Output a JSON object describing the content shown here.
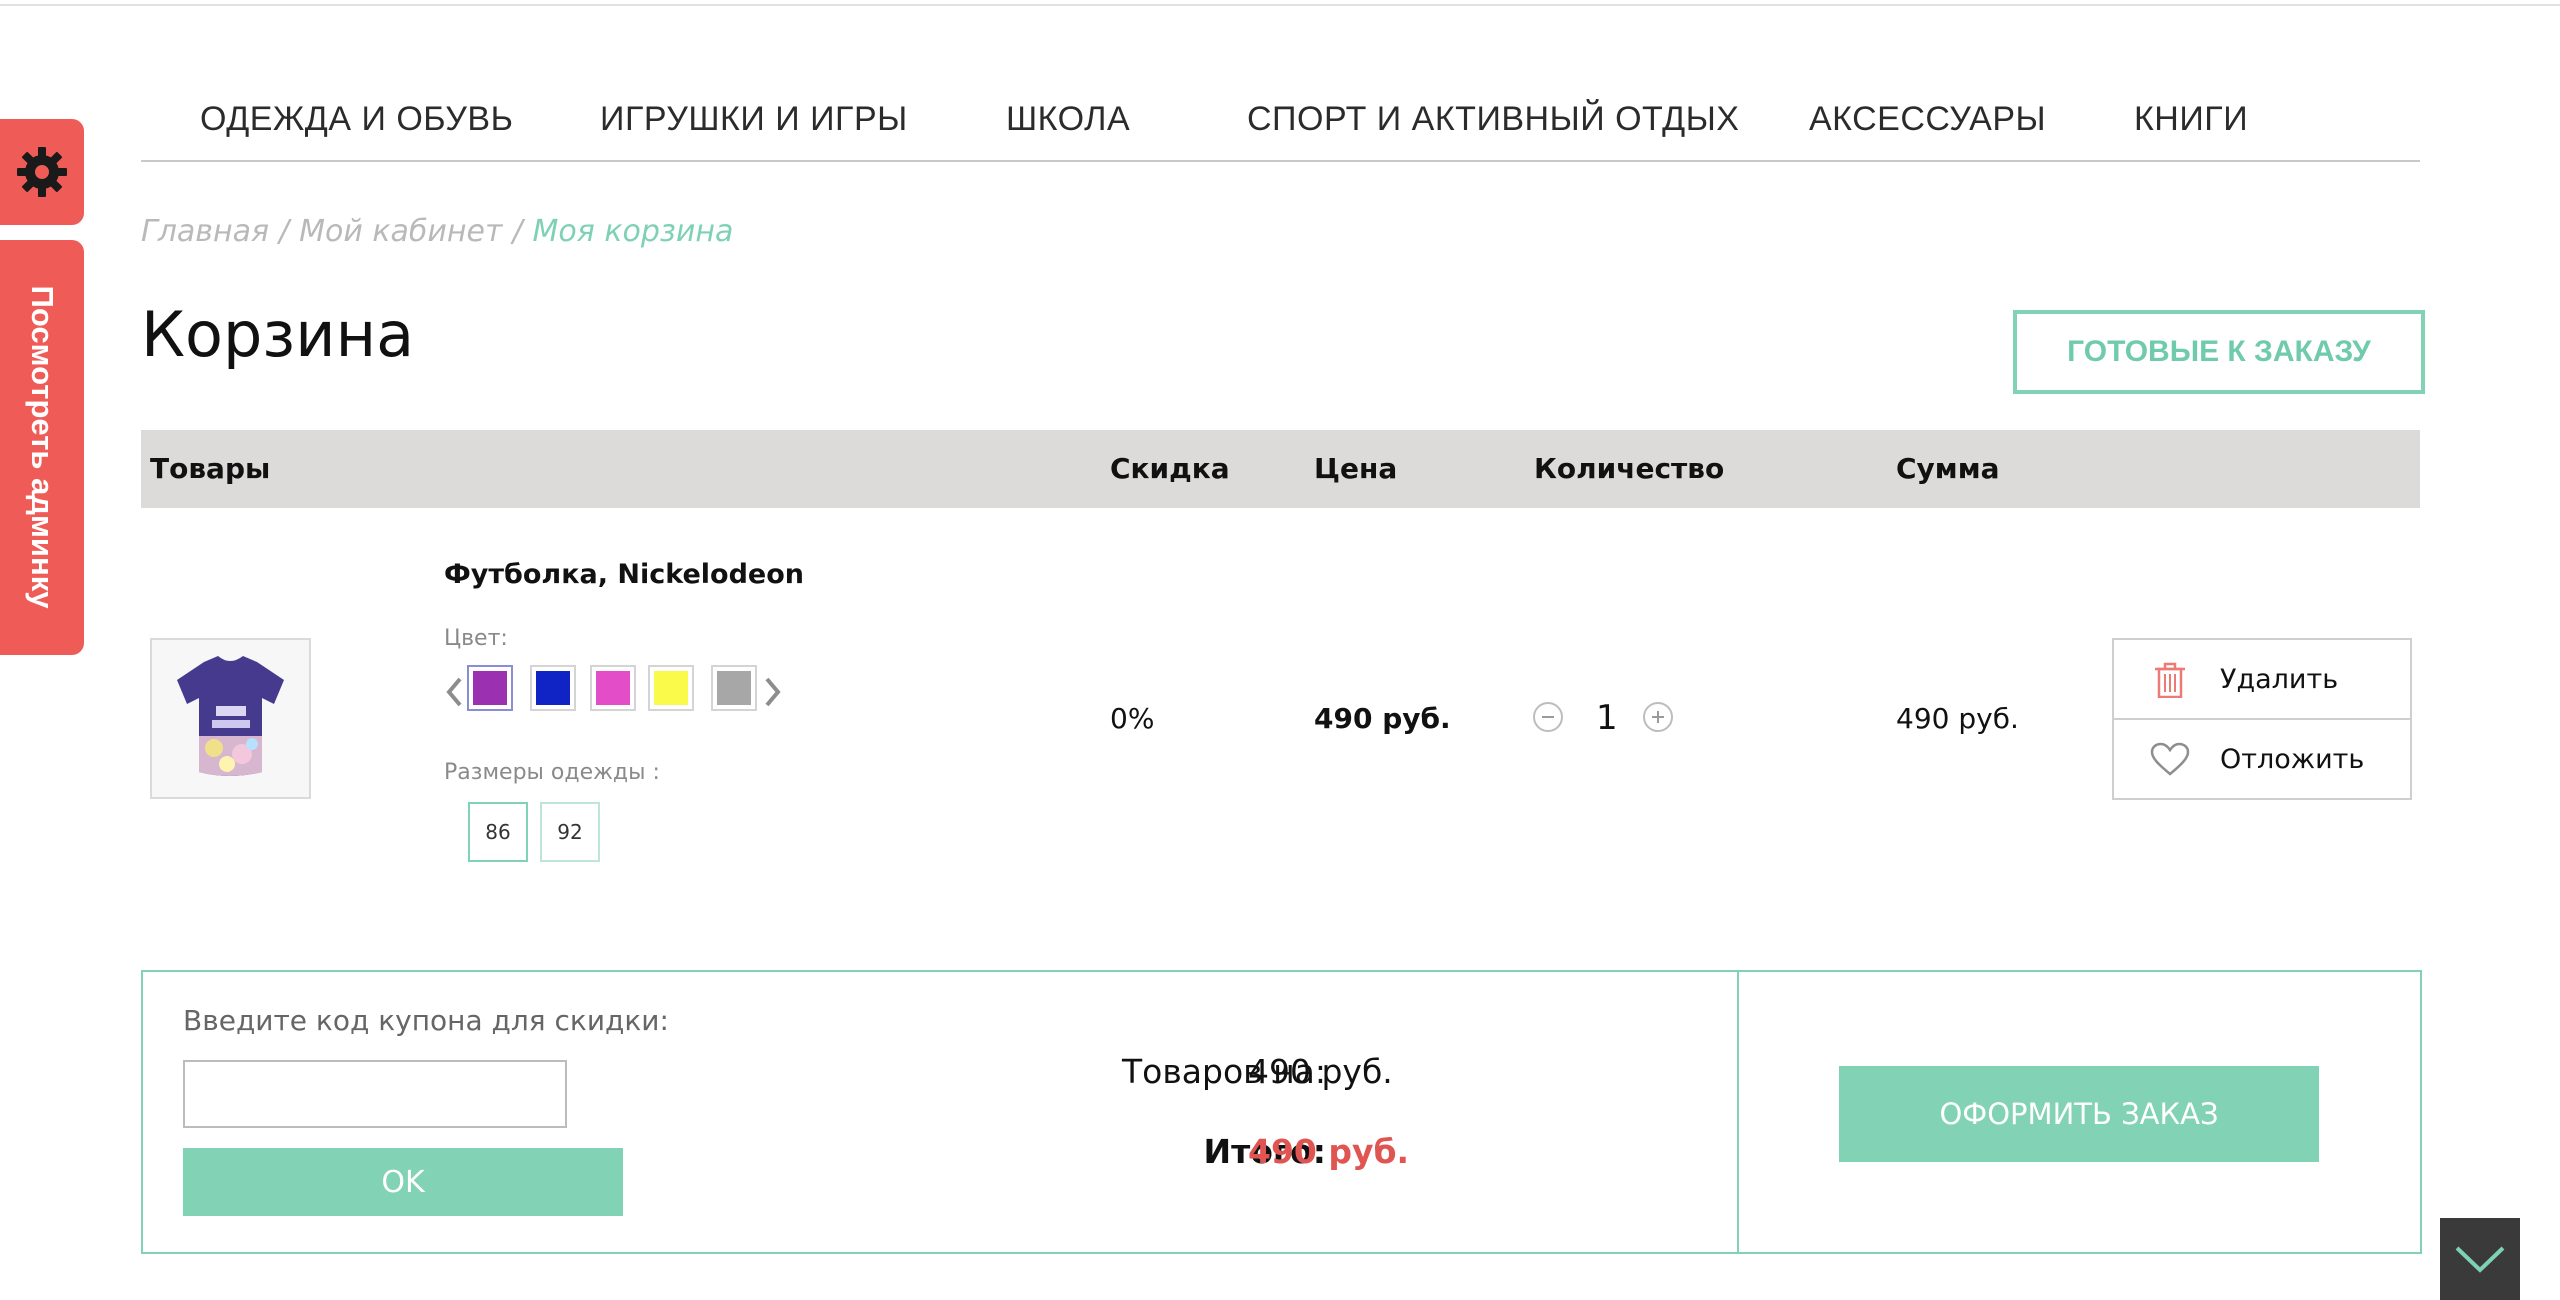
{
  "nav": {
    "items": [
      "ОДЕЖДА И ОБУВЬ",
      "ИГРУШКИ И ИГРЫ",
      "ШКОЛА",
      "СПОРТ И АКТИВНЫЙ ОТДЫХ",
      "АКСЕССУАРЫ",
      "КНИГИ"
    ]
  },
  "admin": {
    "view_label": "Посмотреть админку",
    "gear_icon": "gear-icon",
    "color": "#ef5b57"
  },
  "breadcrumb": {
    "items": [
      "Главная",
      "Мой кабинет",
      "Моя корзина"
    ],
    "separator": "/"
  },
  "page": {
    "title": "Корзина",
    "ready_button": "ГОТОВЫЕ К ЗАКАЗУ",
    "accent": "#82d2b6"
  },
  "table": {
    "headers": {
      "goods": "Товары",
      "discount": "Скидка",
      "price": "Цена",
      "quantity": "Количество",
      "sum": "Сумма"
    }
  },
  "item": {
    "name": "Футболка, Nickelodeon",
    "color_label": "Цвет:",
    "colors": [
      "#9b30b0",
      "#1023c4",
      "#e34dc8",
      "#fafa4a",
      "#a7a7a7"
    ],
    "selected_color_index": 0,
    "sizes_label": "Размеры одежды :",
    "sizes": [
      "86",
      "92"
    ],
    "selected_size_index": 0,
    "discount": "0%",
    "price": "490 руб.",
    "quantity": "1",
    "sum": "490 руб.",
    "delete_label": "Удалить",
    "postpone_label": "Отложить"
  },
  "checkout": {
    "coupon_label": "Введите код купона для скидки:",
    "coupon_value": "",
    "ok_label": "OK",
    "goods_total_label": "Товаров на:",
    "goods_total_value": "490 руб.",
    "total_label": "Итого:",
    "total_value": "490 руб.",
    "checkout_button": "ОФОРМИТЬ ЗАКАЗ"
  }
}
